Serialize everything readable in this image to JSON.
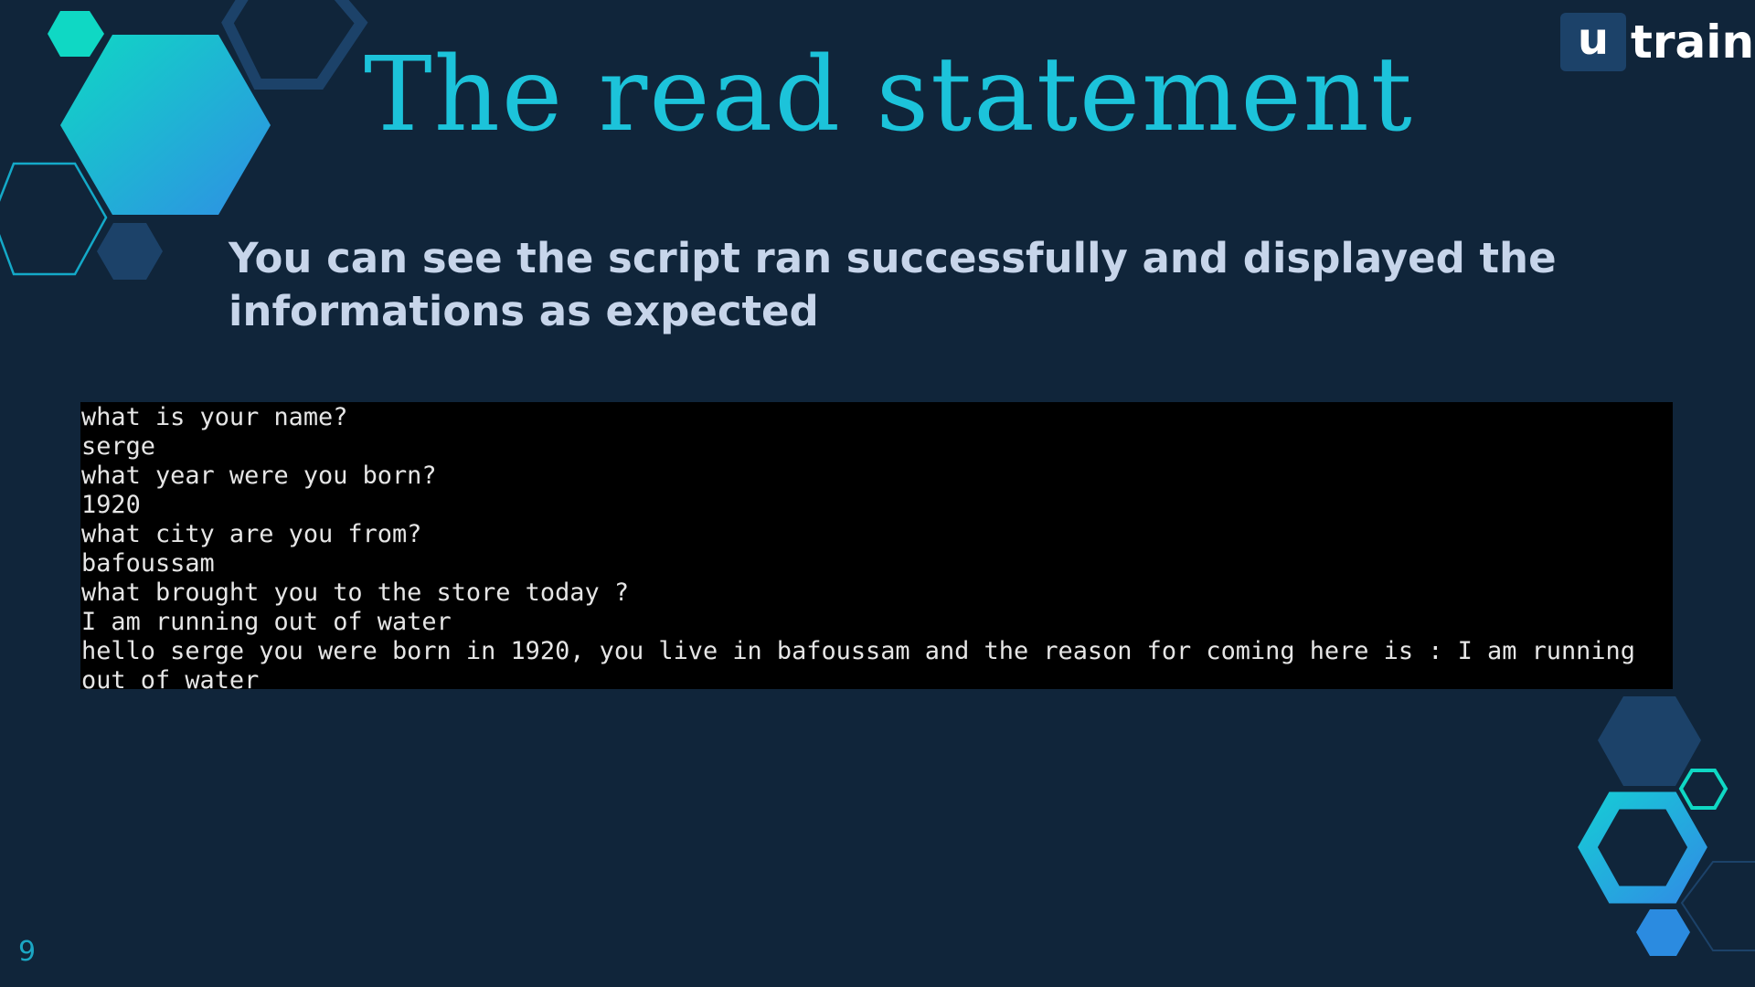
{
  "slide": {
    "title": "The read statement",
    "subtitle_lines": [
      "You can see the script ran successfully and displayed the",
      "informations as expected"
    ],
    "page_number": "9"
  },
  "logo": {
    "badge": "u",
    "text": "train"
  },
  "terminal": {
    "lines": [
      "what is your name?",
      "serge",
      "what year were you born?",
      "1920",
      "what city are you from?",
      "bafoussam",
      "what brought you to the store today ?",
      "I am running out of water",
      "hello serge you were born in 1920, you live in bafoussam and the reason for coming here is : I am running",
      "out of water"
    ]
  },
  "colors": {
    "background": "#10253a",
    "title": "#1cc3da",
    "subtitle": "#c7d5ea",
    "terminal_bg": "#000000",
    "terminal_text": "#e6e6e6",
    "accent_teal": "#0fd8c4",
    "accent_blue": "#2b8be0",
    "dark_hex": "#1c4269"
  }
}
